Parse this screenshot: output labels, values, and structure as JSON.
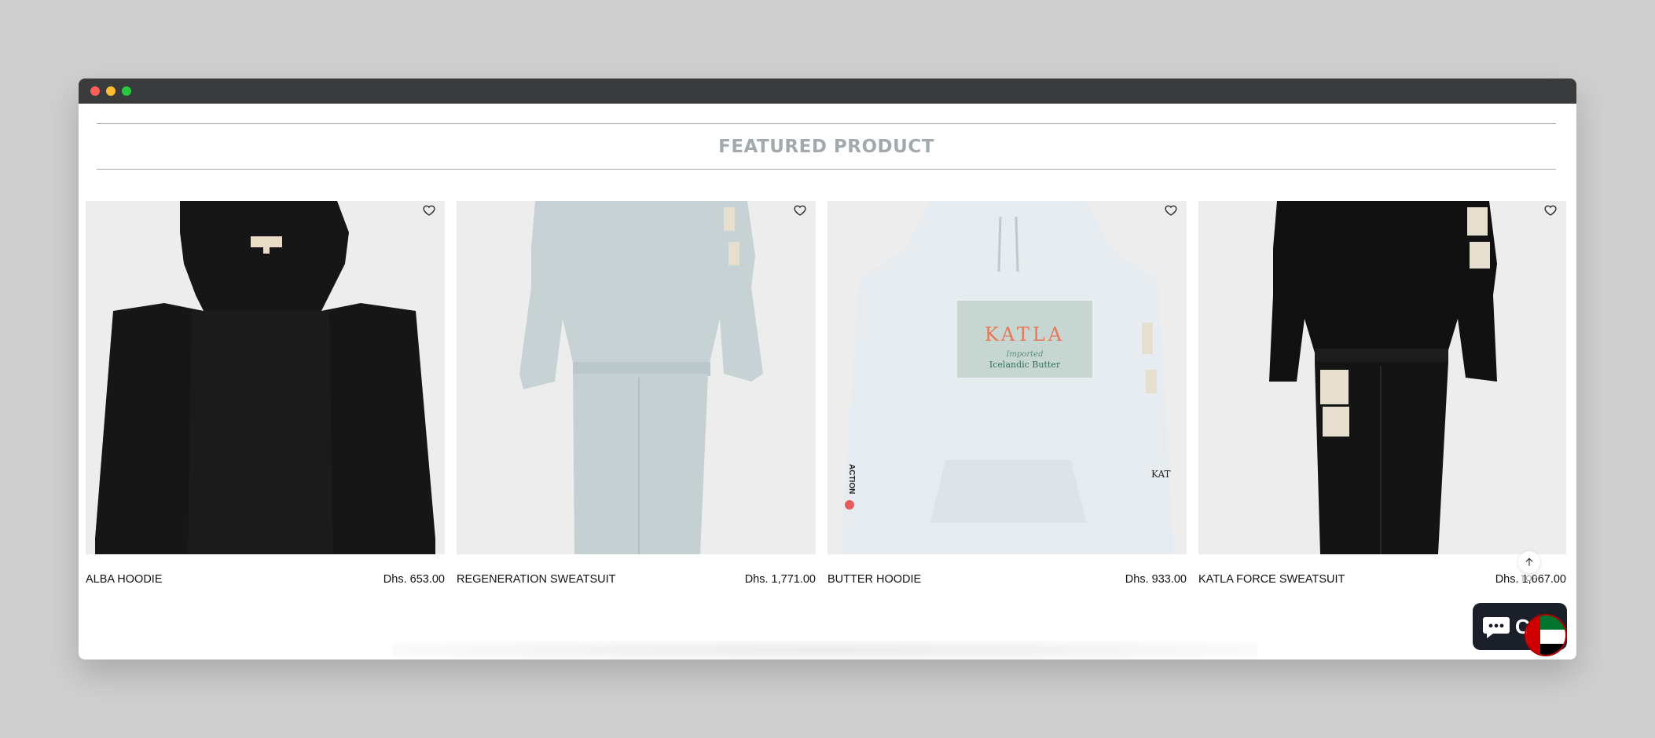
{
  "section": {
    "title": "FEATURED PRODUCT"
  },
  "products": [
    {
      "name": "ALBA HOODIE",
      "price": "Dhs. 653.00",
      "color": "#161616"
    },
    {
      "name": "REGENERATION SWEATSUIT",
      "price": "Dhs. 1,771.00",
      "color": "#c6d2d3"
    },
    {
      "name": "BUTTER HOODIE",
      "price": "Dhs. 933.00",
      "color": "#e6ecef"
    },
    {
      "name": "KATLA FORCE SWEATSUIT",
      "price": "Dhs. 1,067.00",
      "color": "#111111"
    }
  ],
  "print": {
    "brand": "KATLA",
    "sub1": "Imported",
    "sub2": "Icelandic Butter",
    "sleeve": "ACTION",
    "sleeve2": "KAT"
  },
  "scroll_top": {
    "label": "TOP"
  },
  "chat_widget": {
    "label": "C"
  },
  "icons": {
    "wishlist": "heart-outline-icon",
    "scroll_top": "arrow-up-icon",
    "chat": "chat-bubble-icon",
    "flag": "uae-flag-icon"
  }
}
